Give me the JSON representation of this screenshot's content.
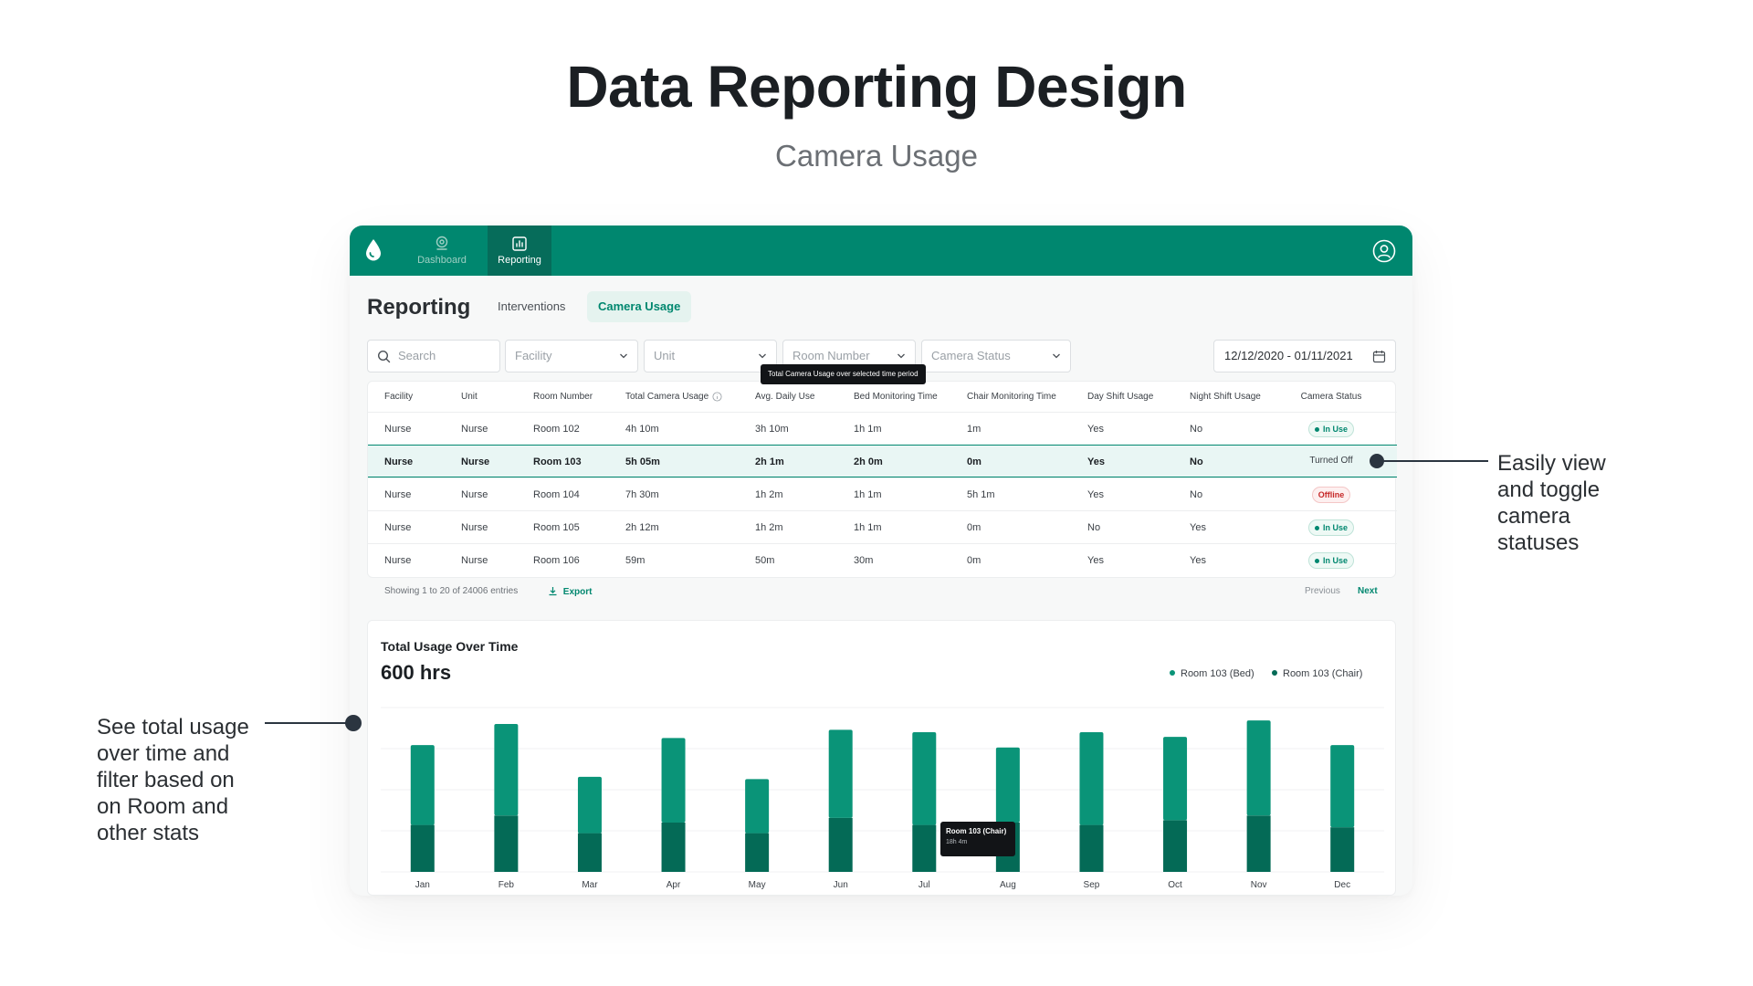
{
  "hero": {
    "title": "Data Reporting Design",
    "subtitle": "Camera Usage"
  },
  "topbar": {
    "logo_icon": "droplet-icon",
    "nav": [
      {
        "label": "Dashboard",
        "icon": "location-pin-icon",
        "active": false
      },
      {
        "label": "Reporting",
        "icon": "report-chart-icon",
        "active": true
      }
    ],
    "profile_icon": "user-circle-icon",
    "color": "#00876f"
  },
  "page": {
    "title": "Reporting",
    "tabs": [
      {
        "label": "Interventions",
        "active": false
      },
      {
        "label": "Camera Usage",
        "active": true
      }
    ]
  },
  "filters": {
    "search_placeholder": "Search",
    "facility": "Facility",
    "unit": "Unit",
    "room_number": "Room Number",
    "camera_status": "Camera Status",
    "date_range": "12/12/2020 - 01/11/2021"
  },
  "header_tooltip": "Total Camera Usage over selected time period",
  "table": {
    "columns": [
      "Facility",
      "Unit",
      "Room Number",
      "Total Camera Usage",
      "Avg. Daily Use",
      "Bed Monitoring Time",
      "Chair Monitoring Time",
      "Day Shift Usage",
      "Night Shift Usage",
      "Camera Status"
    ],
    "rows": [
      {
        "facility": "Nurse",
        "unit": "Nurse",
        "room": "Room 102",
        "total": "4h 10m",
        "avg": "3h 10m",
        "bed": "1h 1m",
        "chair": "1m",
        "day": "Yes",
        "night": "No",
        "status": "In Use",
        "status_type": "inuse"
      },
      {
        "facility": "Nurse",
        "unit": "Nurse",
        "room": "Room 103",
        "total": "5h 05m",
        "avg": "2h 1m",
        "bed": "2h 0m",
        "chair": "0m",
        "day": "Yes",
        "night": "No",
        "status": "Turned Off",
        "status_type": "off"
      },
      {
        "facility": "Nurse",
        "unit": "Nurse",
        "room": "Room 104",
        "total": "7h 30m",
        "avg": "1h 2m",
        "bed": "1h 1m",
        "chair": "5h 1m",
        "day": "Yes",
        "night": "No",
        "status": "Offline",
        "status_type": "offline"
      },
      {
        "facility": "Nurse",
        "unit": "Nurse",
        "room": "Room 105",
        "total": "2h 12m",
        "avg": "1h 2m",
        "bed": "1h 1m",
        "chair": "0m",
        "day": "No",
        "night": "Yes",
        "status": "In Use",
        "status_type": "inuse"
      },
      {
        "facility": "Nurse",
        "unit": "Nurse",
        "room": "Room 106",
        "total": "59m",
        "avg": "50m",
        "bed": "30m",
        "chair": "0m",
        "day": "Yes",
        "night": "Yes",
        "status": "In Use",
        "status_type": "inuse"
      }
    ],
    "selected_row": 1,
    "footer": {
      "showing": "Showing 1 to 20 of 24006 entries",
      "export": "Export",
      "previous": "Previous",
      "next": "Next"
    }
  },
  "chart_card": {
    "title": "Total Usage Over Time",
    "total": "600 hrs",
    "tooltip": {
      "label": "Room 103 (Chair)",
      "value": "18h 4m"
    }
  },
  "chart_data": {
    "type": "bar",
    "stacked": true,
    "categories": [
      "Jan",
      "Feb",
      "Mar",
      "Apr",
      "May",
      "Jun",
      "Jul",
      "Aug",
      "Sep",
      "Oct",
      "Nov",
      "Dec"
    ],
    "series": [
      {
        "name": "Room 103 (Bed)",
        "color": "#0a9478",
        "values": [
          68,
          78,
          48,
          72,
          46,
          75,
          79,
          64,
          79,
          71,
          81,
          70
        ]
      },
      {
        "name": "Room 103 (Chair)",
        "color": "#046a56",
        "values": [
          40,
          48,
          33,
          42,
          33,
          46,
          40,
          42,
          40,
          44,
          48,
          38
        ]
      }
    ],
    "ylim": [
      0,
      140
    ],
    "grid": true,
    "legend_position": "top-right"
  },
  "annotations": {
    "right": "Easily view and toggle camera statuses",
    "left": "See total usage over time and filter based on on Room and other stats"
  }
}
